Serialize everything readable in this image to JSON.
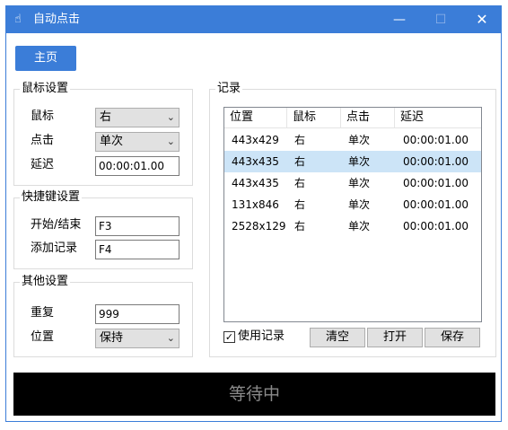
{
  "window": {
    "title": "自动点击",
    "minimize": "—",
    "maximize": "☐",
    "close": "✕"
  },
  "home_button": "主页",
  "mouse_settings": {
    "title": "鼠标设置",
    "button_label": "鼠标",
    "button_value": "右",
    "click_label": "点击",
    "click_value": "单次",
    "delay_label": "延迟",
    "delay_value": "00:00:01.00"
  },
  "hotkey_settings": {
    "title": "快捷键设置",
    "start_label": "开始/结束",
    "start_value": "F3",
    "record_label": "添加记录",
    "record_value": "F4"
  },
  "other_settings": {
    "title": "其他设置",
    "repeat_label": "重复",
    "repeat_value": "999",
    "position_label": "位置",
    "position_value": "保持"
  },
  "records": {
    "title": "记录",
    "columns": [
      "位置",
      "鼠标",
      "点击",
      "延迟"
    ],
    "rows": [
      {
        "pos": "443x429",
        "button": "右",
        "click": "单次",
        "delay": "00:00:01.00",
        "selected": false
      },
      {
        "pos": "443x435",
        "button": "右",
        "click": "单次",
        "delay": "00:00:01.00",
        "selected": true
      },
      {
        "pos": "443x435",
        "button": "右",
        "click": "单次",
        "delay": "00:00:01.00",
        "selected": false
      },
      {
        "pos": "131x846",
        "button": "右",
        "click": "单次",
        "delay": "00:00:01.00",
        "selected": false
      },
      {
        "pos": "2528x129",
        "button": "右",
        "click": "单次",
        "delay": "00:00:01.00",
        "selected": false
      }
    ],
    "use_records_label": "使用记录",
    "use_records_checked": true,
    "clear_label": "清空",
    "open_label": "打开",
    "save_label": "保存"
  },
  "status_text": "等待中",
  "colors": {
    "accent": "#3b7dd8",
    "selected_row": "#cce4f7",
    "status_bg": "#000000"
  }
}
